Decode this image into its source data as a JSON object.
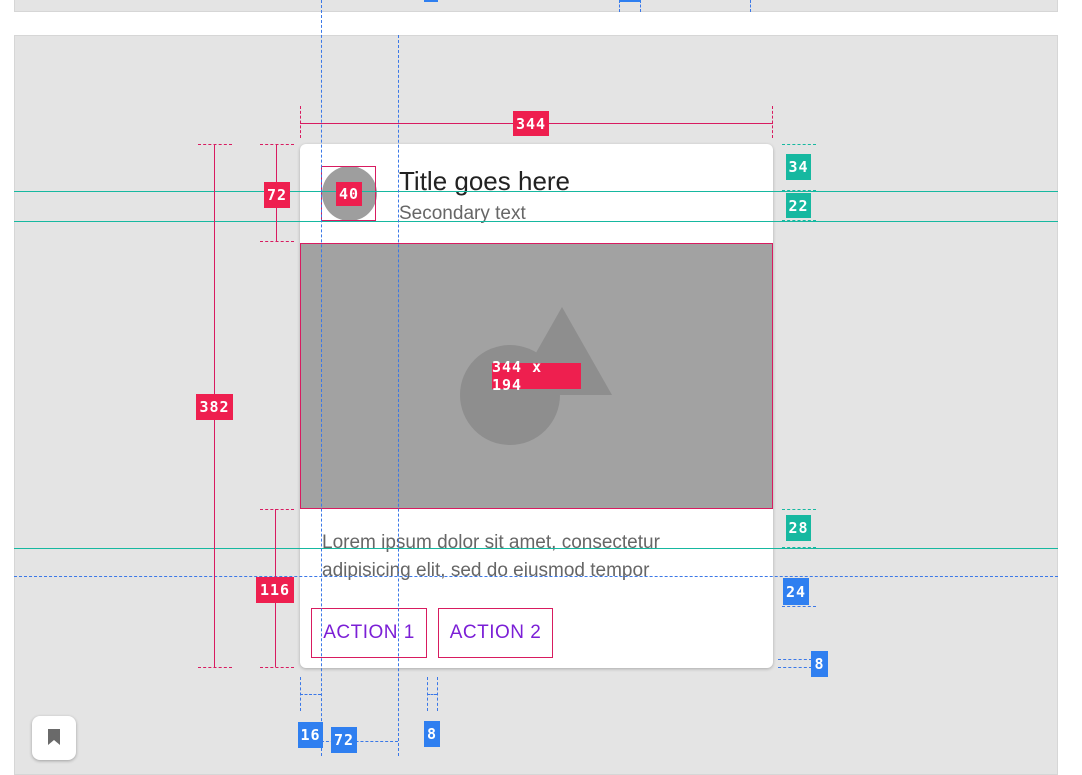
{
  "card": {
    "title": "Title goes here",
    "secondary": "Secondary text",
    "body": "Lorem ipsum dolor sit amet, consectetur adipisicing elit, sed do eiusmod tempor",
    "actions": [
      "ACTION 1",
      "ACTION 2"
    ]
  },
  "specs": {
    "card_width": "344",
    "card_height": "382",
    "header_height": "72",
    "avatar_size": "40",
    "media_size": "344 x 194",
    "title_baseline": "34",
    "subtitle_baseline": "22",
    "body_baseline": "28",
    "body_bottom": "24",
    "actions_height": "116",
    "actions_padding": "8",
    "left_padding": "16",
    "text_offset": "72",
    "button_gap": "8"
  },
  "colors": {
    "spec_red": "#ee1f4f",
    "spec_teal": "#16b8a0",
    "spec_blue": "#2f7ff0",
    "action_text": "#7b1fd6"
  },
  "icons": {
    "bookmark": "bookmark-icon"
  }
}
